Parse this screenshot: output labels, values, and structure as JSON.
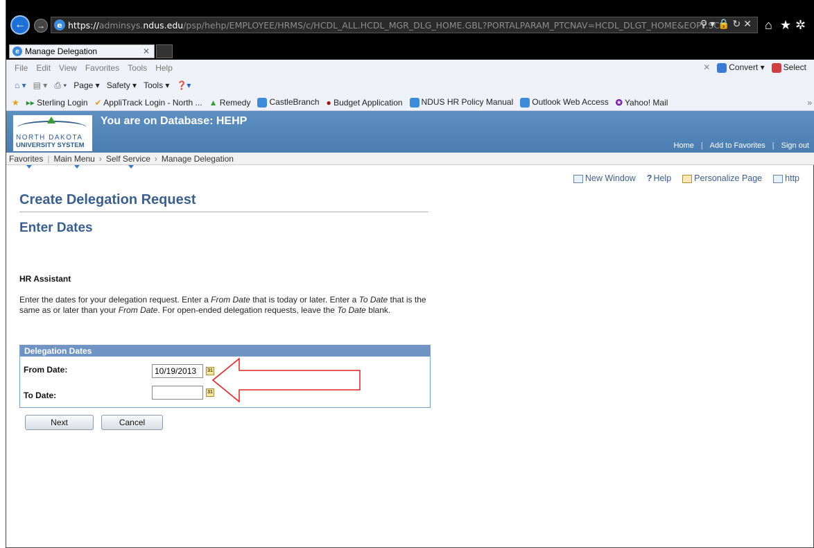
{
  "browser": {
    "url_prefix": "https://",
    "url_host_dim": "adminsys.",
    "url_host": "ndus.edu",
    "url_path": "/psp/hehp/EMPLOYEE/HRMS/c/HCDL_ALL.HCDL_MGR_DLG_HOME.GBL?PORTALPARAM_PTCNAV=HCDL_DLGT_HOME&EOPP.SCN",
    "tab_title": "Manage Delegation",
    "menu": [
      "File",
      "Edit",
      "View",
      "Favorites",
      "Tools",
      "Help"
    ],
    "commands": [
      "Page ▾",
      "Safety ▾",
      "Tools ▾"
    ],
    "convert_label": "Convert",
    "select_label": "Select",
    "favorites": [
      "Sterling Login",
      "AppliTrack Login - North ...",
      "Remedy",
      "CastleBranch",
      "Budget Application",
      "NDUS HR Policy Manual",
      "Outlook Web Access",
      "Yahoo! Mail"
    ]
  },
  "header": {
    "logo_line1": "NORTH DAKOTA",
    "logo_line2": "UNIVERSITY SYSTEM",
    "db_title": "You are on Database: HEHP",
    "links": [
      "Home",
      "Add to Favorites",
      "Sign out"
    ]
  },
  "breadcrumb": [
    "Favorites",
    "Main Menu",
    "Self Service",
    "Manage Delegation"
  ],
  "page_tools": {
    "new_window": "New Window",
    "help": "Help",
    "personalize": "Personalize Page",
    "http": "http"
  },
  "page": {
    "title": "Create Delegation Request",
    "subtitle": "Enter Dates",
    "section": "HR Assistant",
    "instructions_html": "Enter the dates for your delegation request. Enter a <i>From Date</i> that is today or later. Enter a <i>To Date</i> that is the same as or later than your <i>From Date</i>. For open-ended delegation requests, leave the <i>To Date</i> blank.",
    "box_title": "Delegation Dates",
    "from_label": "From Date:",
    "from_value": "10/19/2013",
    "to_label": "To Date:",
    "to_value": "",
    "next_label": "Next",
    "cancel_label": "Cancel"
  },
  "colors": {
    "header_blue": "#4c7db1",
    "title_blue": "#3a5f8e",
    "annotation_arrow": "#e02020"
  }
}
